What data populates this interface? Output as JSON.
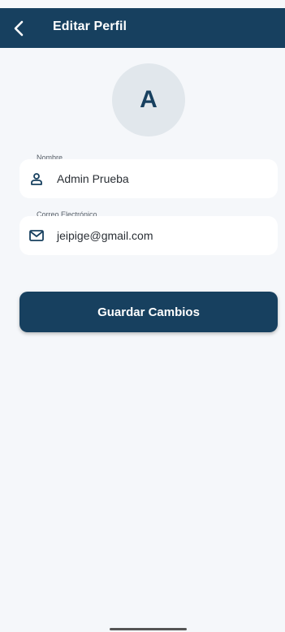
{
  "app_bar": {
    "title": "Editar Perfil",
    "back_icon": "chevron-left-icon",
    "background_color": "#17405f"
  },
  "avatar": {
    "initial": "A"
  },
  "form": {
    "name": {
      "label": "Nombre",
      "value": "Admin Prueba",
      "icon": "person-icon"
    },
    "email": {
      "label": "Correo Electrónico",
      "value": "jeipige@gmail.com",
      "icon": "mail-icon"
    }
  },
  "save_button": {
    "label": "Guardar Cambios"
  },
  "colors": {
    "primary": "#17405f",
    "background": "#f5f7fa",
    "avatar_bg": "#e1e7ec"
  }
}
